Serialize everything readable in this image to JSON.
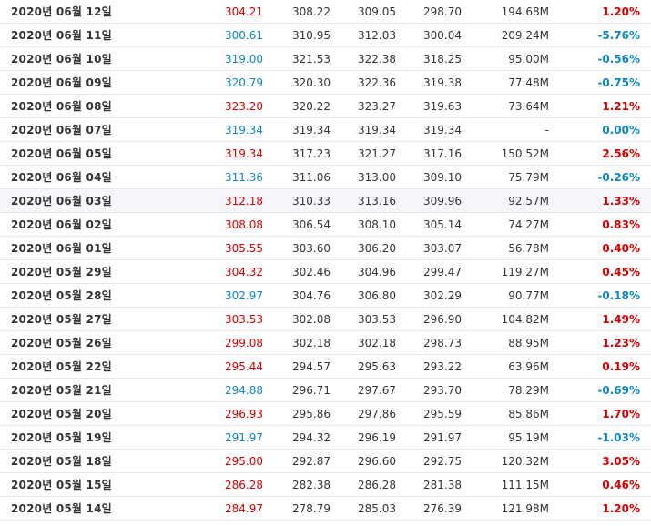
{
  "rows": [
    {
      "date": "2020년 06월 12일",
      "close": "304.21",
      "open": "308.22",
      "high": "309.05",
      "low": "298.70",
      "volume": "194.68M",
      "change": "1.20%",
      "dir": "up"
    },
    {
      "date": "2020년 06월 11일",
      "close": "300.61",
      "open": "310.95",
      "high": "312.03",
      "low": "300.04",
      "volume": "209.24M",
      "change": "-5.76%",
      "dir": "down"
    },
    {
      "date": "2020년 06월 10일",
      "close": "319.00",
      "open": "321.53",
      "high": "322.38",
      "low": "318.25",
      "volume": "95.00M",
      "change": "-0.56%",
      "dir": "down"
    },
    {
      "date": "2020년 06월 09일",
      "close": "320.79",
      "open": "320.30",
      "high": "322.36",
      "low": "319.38",
      "volume": "77.48M",
      "change": "-0.75%",
      "dir": "down"
    },
    {
      "date": "2020년 06월 08일",
      "close": "323.20",
      "open": "320.22",
      "high": "323.27",
      "low": "319.63",
      "volume": "73.64M",
      "change": "1.21%",
      "dir": "up"
    },
    {
      "date": "2020년 06월 07일",
      "close": "319.34",
      "open": "319.34",
      "high": "319.34",
      "low": "319.34",
      "volume": "-",
      "change": "0.00%",
      "dir": "flat"
    },
    {
      "date": "2020년 06월 05일",
      "close": "319.34",
      "open": "317.23",
      "high": "321.27",
      "low": "317.16",
      "volume": "150.52M",
      "change": "2.56%",
      "dir": "up"
    },
    {
      "date": "2020년 06월 04일",
      "close": "311.36",
      "open": "311.06",
      "high": "313.00",
      "low": "309.10",
      "volume": "75.79M",
      "change": "-0.26%",
      "dir": "down"
    },
    {
      "date": "2020년 06월 03일",
      "close": "312.18",
      "open": "310.33",
      "high": "313.16",
      "low": "309.96",
      "volume": "92.57M",
      "change": "1.33%",
      "dir": "up",
      "highlight": true
    },
    {
      "date": "2020년 06월 02일",
      "close": "308.08",
      "open": "306.54",
      "high": "308.10",
      "low": "305.14",
      "volume": "74.27M",
      "change": "0.83%",
      "dir": "up"
    },
    {
      "date": "2020년 06월 01일",
      "close": "305.55",
      "open": "303.60",
      "high": "306.20",
      "low": "303.07",
      "volume": "56.78M",
      "change": "0.40%",
      "dir": "up"
    },
    {
      "date": "2020년 05월 29일",
      "close": "304.32",
      "open": "302.46",
      "high": "304.96",
      "low": "299.47",
      "volume": "119.27M",
      "change": "0.45%",
      "dir": "up"
    },
    {
      "date": "2020년 05월 28일",
      "close": "302.97",
      "open": "304.76",
      "high": "306.80",
      "low": "302.29",
      "volume": "90.77M",
      "change": "-0.18%",
      "dir": "down"
    },
    {
      "date": "2020년 05월 27일",
      "close": "303.53",
      "open": "302.08",
      "high": "303.53",
      "low": "296.90",
      "volume": "104.82M",
      "change": "1.49%",
      "dir": "up"
    },
    {
      "date": "2020년 05월 26일",
      "close": "299.08",
      "open": "302.18",
      "high": "302.18",
      "low": "298.73",
      "volume": "88.95M",
      "change": "1.23%",
      "dir": "up"
    },
    {
      "date": "2020년 05월 22일",
      "close": "295.44",
      "open": "294.57",
      "high": "295.63",
      "low": "293.22",
      "volume": "63.96M",
      "change": "0.19%",
      "dir": "up"
    },
    {
      "date": "2020년 05월 21일",
      "close": "294.88",
      "open": "296.71",
      "high": "297.67",
      "low": "293.70",
      "volume": "78.29M",
      "change": "-0.69%",
      "dir": "down"
    },
    {
      "date": "2020년 05월 20일",
      "close": "296.93",
      "open": "295.86",
      "high": "297.86",
      "low": "295.59",
      "volume": "85.86M",
      "change": "1.70%",
      "dir": "up"
    },
    {
      "date": "2020년 05월 19일",
      "close": "291.97",
      "open": "294.32",
      "high": "296.19",
      "low": "291.97",
      "volume": "95.19M",
      "change": "-1.03%",
      "dir": "down"
    },
    {
      "date": "2020년 05월 18일",
      "close": "295.00",
      "open": "292.87",
      "high": "296.60",
      "low": "292.75",
      "volume": "120.32M",
      "change": "3.05%",
      "dir": "up"
    },
    {
      "date": "2020년 05월 15일",
      "close": "286.28",
      "open": "282.38",
      "high": "286.28",
      "low": "281.38",
      "volume": "111.15M",
      "change": "0.46%",
      "dir": "up"
    },
    {
      "date": "2020년 05월 14일",
      "close": "284.97",
      "open": "278.79",
      "high": "285.03",
      "low": "276.39",
      "volume": "121.98M",
      "change": "1.20%",
      "dir": "up"
    }
  ],
  "colors": {
    "up": "#d60000",
    "down": "#0e86c4",
    "text": "#333333",
    "row_border": "#e6e6e6",
    "row_highlight": "#f4f6f9"
  }
}
